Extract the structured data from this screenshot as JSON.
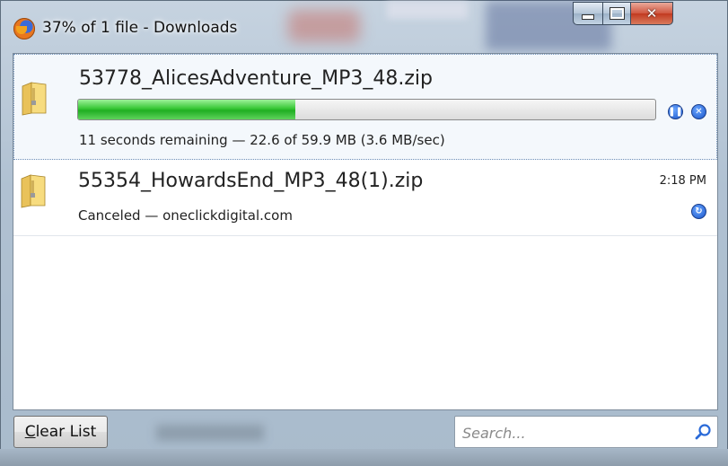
{
  "window": {
    "title": "37% of 1 file - Downloads",
    "caption_buttons": {
      "minimize": "minimize-icon",
      "maximize": "maximize-icon",
      "close": "close-icon"
    }
  },
  "downloads": [
    {
      "filename": "53778_AlicesAdventure_MP3_48.zip",
      "status": "11 seconds remaining — 22.6 of 59.9 MB (3.6 MB/sec)",
      "progress_fraction": 0.377,
      "icon": "zip-folder-icon",
      "actions": [
        "pause-icon",
        "cancel-icon"
      ]
    },
    {
      "filename": "55354_HowardsEnd_MP3_48(1).zip",
      "status": "Canceled — oneclickdigital.com",
      "time": "2:18 PM",
      "icon": "zip-folder-icon",
      "actions": [
        "retry-icon"
      ]
    }
  ],
  "footer": {
    "clear_button": {
      "accel": "C",
      "rest": "lear List"
    },
    "search": {
      "placeholder": "Search...",
      "value": "",
      "icon": "search-icon"
    }
  },
  "colors": {
    "progress": "#2ebd2e",
    "action_blue": "#1a55c9",
    "close_red": "#c9452a"
  }
}
